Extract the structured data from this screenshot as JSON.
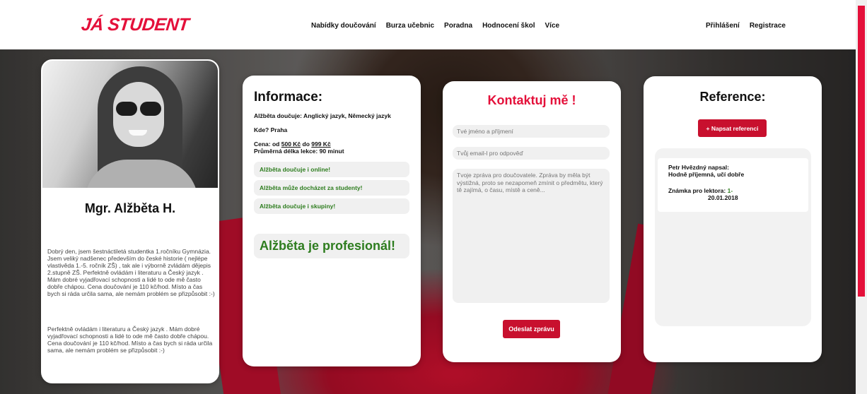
{
  "header": {
    "logo": "JÁ STUDENT",
    "nav": [
      "Nabídky doučování",
      "Burza učebnic",
      "Poradna",
      "Hodnocení škol",
      "Více"
    ],
    "auth": [
      "Přihlášení",
      "Registrace"
    ]
  },
  "profile": {
    "name": "Mgr. Alžběta H.",
    "bio1": "Dobrý den, jsem šestnáctiletá studentka 1.ročníku Gymnázia. Jsem veliký nadšenec především do české historie ( nejlépe vlastivěda 1.-5. ročník ZŠ) , tak ale i výborně zvládám dějepis 2.stupně ZŠ. Perfektně ovládám i literaturu a Český jazyk . Mám dobré vyjadřovací schopnosti a lidé to ode mě často dobře chápou. Cena doučování je 110 kč/hod. Místo a čas bych si ráda určila sama, ale nemám problém se přizpůsobit :-)",
    "bio2": "Perfektně ovládám i literaturu a Český jazyk . Mám dobré vyjadřovací schopnosti a lidé to ode mě často dobře chápou. Cena doučování je 110 kč/hod. Místo a čas bych si ráda určila sama, ale nemám problém se přizpůsobit :-)"
  },
  "info": {
    "title": "Informace:",
    "subjects": "Alžběta doučuje: Anglický jazyk, Německý jazyk",
    "where": "Kde? Praha",
    "price_prefix": "Cena: od ",
    "price_from": "500 Kč",
    "price_mid": " do ",
    "price_to": "999 Kč",
    "lesson_length": "Průměrná délka lekce: 90 minut",
    "features": [
      "Alžběta doučuje i online!",
      "Alžběta může docházet za studenty!",
      "Alžběta doučuje i skupiny!"
    ],
    "pro_badge": "Alžběta je profesionál!"
  },
  "contact": {
    "title": "Kontaktuj mě !",
    "name_placeholder": "Tvé jméno a příjmení",
    "email_placeholder": "Tvůj email-l pro odpověď",
    "message_placeholder": "Tvoje zpráva pro doučovatele. Zpráva by měla být výstižná, proto se nezapomeň zmínit o předmětu, který tě zajímá, o času, místě a ceně...",
    "send_label": "Odeslat zprávu"
  },
  "reference": {
    "title": "Reference:",
    "add_label": "+ Napsat referenci",
    "items": [
      {
        "author": "Petr Hvězdný napsal:",
        "text": "Hodně příjemná, učí dobře",
        "grade_label": "Známka pro lektora: ",
        "grade": "1-",
        "date": "20.01.2018"
      }
    ]
  },
  "colors": {
    "brand": "#e4103a",
    "button": "#c8102e",
    "feature_text": "#2e7d1f"
  }
}
